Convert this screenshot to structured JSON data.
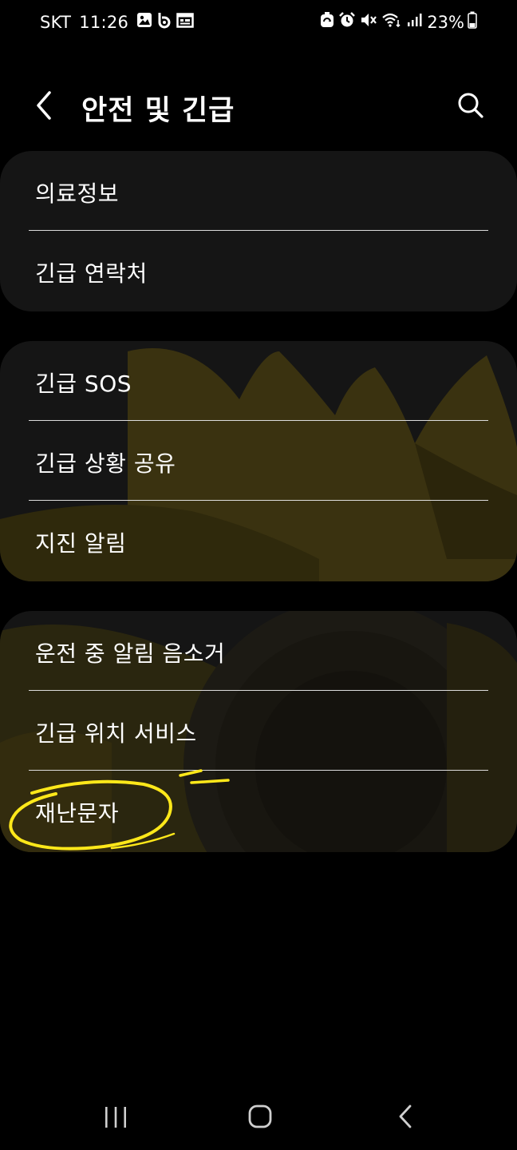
{
  "status_bar": {
    "carrier": "SKT",
    "time": "11:26",
    "battery_percent": "23%",
    "left_icons": [
      "gallery-icon",
      "bixby-icon",
      "calendar-icon"
    ],
    "right_icons": [
      "recycle-icon",
      "alarm-icon",
      "mute-icon",
      "wifi-icon",
      "signal-icon",
      "battery-icon"
    ]
  },
  "header": {
    "title": "안전 및 긴급"
  },
  "groups": [
    {
      "items": [
        {
          "label": "의료정보"
        },
        {
          "label": "긴급 연락처"
        }
      ]
    },
    {
      "items": [
        {
          "label": "긴급 SOS"
        },
        {
          "label": "긴급 상황 공유"
        },
        {
          "label": "지진 알림"
        }
      ]
    },
    {
      "items": [
        {
          "label": "운전 중 알림 음소거"
        },
        {
          "label": "긴급 위치 서비스"
        },
        {
          "label": "재난문자"
        }
      ]
    }
  ],
  "colors": {
    "background": "#000000",
    "card": "#151515",
    "sunflower_petal": "#3a3210",
    "annotation": "#ffe81a",
    "text": "#ffffff"
  },
  "nav_bar": {
    "icons": [
      "recents-icon",
      "home-icon",
      "back-icon"
    ]
  }
}
